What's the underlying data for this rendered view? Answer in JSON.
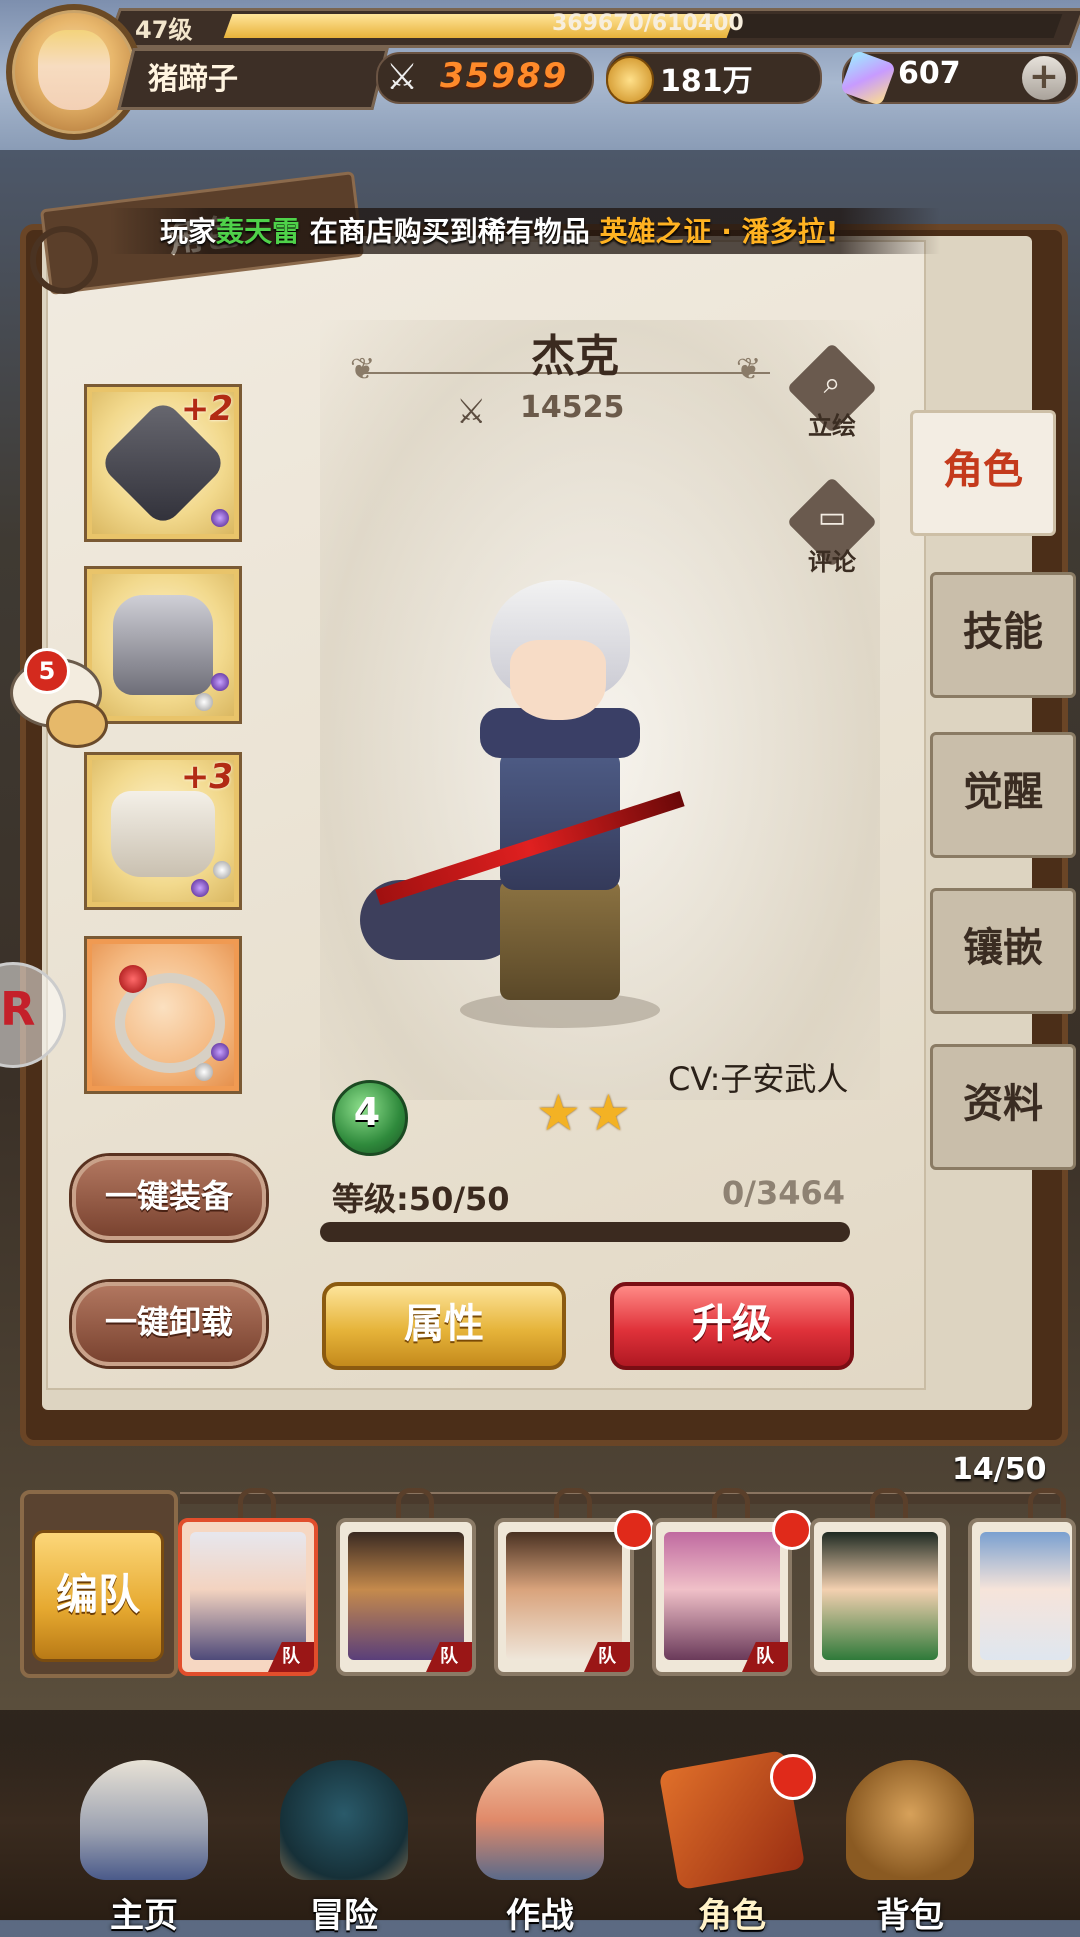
{
  "player": {
    "level": "47级",
    "exp": "369670/610400",
    "exp_progress": 0.606,
    "name": "猪蹄子"
  },
  "resources": {
    "power": "35989",
    "gold": "181万",
    "gems": "607",
    "add_label": "+"
  },
  "ticker": {
    "prefix": "玩家",
    "player": "轰天雷",
    "middle": "在商店购买到稀有物品",
    "item": "英雄之证 · 潘多拉!"
  },
  "page_tab_title": "角色",
  "character": {
    "name": "杰克",
    "power": "14525",
    "cv": "CV:子安武人",
    "rank": "4",
    "stars": 2,
    "level_text": "等级:50/50",
    "exp_text": "0/3464",
    "actions": [
      {
        "label": "立绘",
        "icon": "magnifier-icon"
      },
      {
        "label": "评论",
        "icon": "comment-icon"
      }
    ]
  },
  "equipment": [
    {
      "slot": "weapon",
      "plus": "+2"
    },
    {
      "slot": "armor",
      "plus": ""
    },
    {
      "slot": "boots",
      "plus": "+3"
    },
    {
      "slot": "ring",
      "plus": ""
    }
  ],
  "chat_badge": "5",
  "buttons": {
    "auto_equip": "一键装备",
    "auto_unequip": "一键卸载",
    "attributes": "属性",
    "upgrade": "升级"
  },
  "tabs": [
    "角色",
    "技能",
    "觉醒",
    "镶嵌",
    "资料"
  ],
  "roster": {
    "count": "14/50",
    "team_button": "编队",
    "team_tag": "队"
  },
  "nav": [
    "主页",
    "冒险",
    "作战",
    "角色",
    "背包"
  ],
  "colors": {
    "accent_red": "#e0323a",
    "accent_gold": "#e6b43a",
    "ticker_green": "#4fd24a",
    "ticker_orange": "#ffb221",
    "active_tab": "#c43a1c"
  }
}
